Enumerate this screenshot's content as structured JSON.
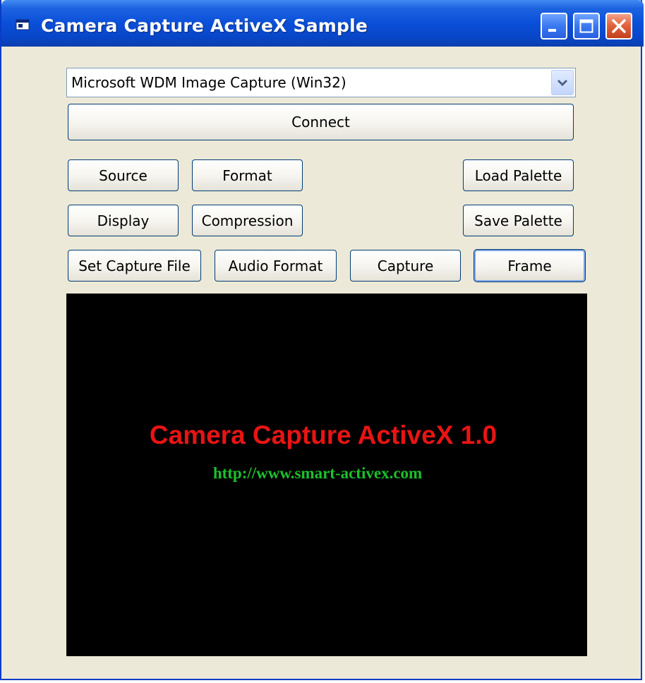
{
  "window": {
    "title": "Camera Capture ActiveX Sample",
    "icons": {
      "app": "app-window-icon",
      "minimize": "minimize-icon",
      "maximize": "maximize-icon",
      "close": "close-icon"
    },
    "colors": {
      "titlebar": "#0a4fd8",
      "close": "#e2643f",
      "body": "#ece9d8"
    }
  },
  "device": {
    "selected": "Microsoft WDM Image Capture (Win32)",
    "arrow_icon": "chevron-down-icon"
  },
  "buttons": {
    "connect": "Connect",
    "source": "Source",
    "format": "Format",
    "load_palette": "Load Palette",
    "display": "Display",
    "compression": "Compression",
    "save_palette": "Save Palette",
    "set_capture_file": "Set Capture File",
    "audio_format": "Audio Format",
    "capture": "Capture",
    "frame": "Frame"
  },
  "preview": {
    "title": "Camera Capture ActiveX 1.0",
    "url": "http://www.smart-activex.com",
    "colors": {
      "background": "#000000",
      "title": "#e81414",
      "url": "#1bc12b"
    }
  }
}
